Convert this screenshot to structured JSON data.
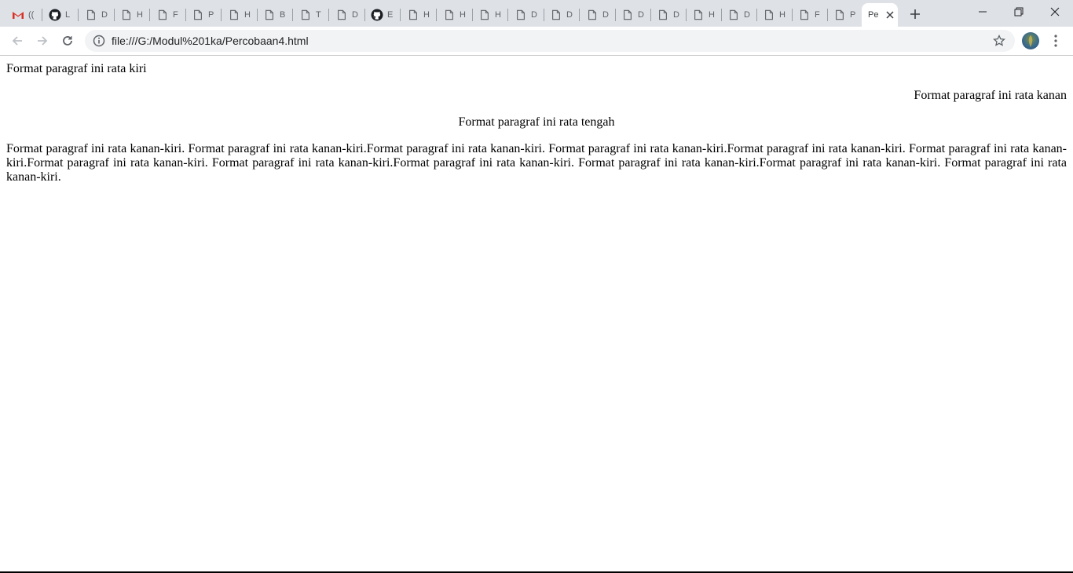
{
  "browser": {
    "tabs": [
      {
        "icon": "gmail-icon",
        "title": "(("
      },
      {
        "icon": "github-icon",
        "title": "L"
      },
      {
        "icon": "page-icon",
        "title": "D"
      },
      {
        "icon": "page-icon",
        "title": "H"
      },
      {
        "icon": "page-icon",
        "title": "F"
      },
      {
        "icon": "page-icon",
        "title": "P"
      },
      {
        "icon": "page-icon",
        "title": "H"
      },
      {
        "icon": "page-icon",
        "title": "B"
      },
      {
        "icon": "page-icon",
        "title": "T"
      },
      {
        "icon": "page-icon",
        "title": "D"
      },
      {
        "icon": "github-icon",
        "title": "E"
      },
      {
        "icon": "page-icon",
        "title": "H"
      },
      {
        "icon": "page-icon",
        "title": "H"
      },
      {
        "icon": "page-icon",
        "title": "H"
      },
      {
        "icon": "page-icon",
        "title": "D"
      },
      {
        "icon": "page-icon",
        "title": "D"
      },
      {
        "icon": "page-icon",
        "title": "D"
      },
      {
        "icon": "page-icon",
        "title": "D"
      },
      {
        "icon": "page-icon",
        "title": "D"
      },
      {
        "icon": "page-icon",
        "title": "H"
      },
      {
        "icon": "page-icon",
        "title": "D"
      },
      {
        "icon": "page-icon",
        "title": "H"
      },
      {
        "icon": "page-icon",
        "title": "F"
      },
      {
        "icon": "page-icon",
        "title": "P"
      }
    ],
    "active_tab": {
      "title": "Pe",
      "close_icon": "close-icon"
    },
    "new_tab_icon": "plus-icon",
    "window_controls": [
      "minimize-icon",
      "restore-icon",
      "close-icon"
    ],
    "url": "file:///G:/Modul%201ka/Percobaan4.html",
    "colors": {
      "tabstrip": "#dee1e6",
      "omnibox": "#f1f3f4",
      "gmail_red": "#d93025"
    }
  },
  "page": {
    "p_left": "Format paragraf ini rata kiri",
    "p_right": "Format paragraf ini rata kanan",
    "p_center": "Format paragraf ini rata tengah",
    "p_justify": "Format paragraf ini rata kanan-kiri. Format paragraf ini rata kanan-kiri.Format paragraf ini rata kanan-kiri. Format paragraf ini rata kanan-kiri.Format paragraf ini rata kanan-kiri. Format paragraf ini rata kanan-kiri.Format paragraf ini rata kanan-kiri. Format paragraf ini rata kanan-kiri.Format paragraf ini rata kanan-kiri. Format paragraf ini rata kanan-kiri.Format paragraf ini rata kanan-kiri. Format paragraf ini rata kanan-kiri."
  }
}
